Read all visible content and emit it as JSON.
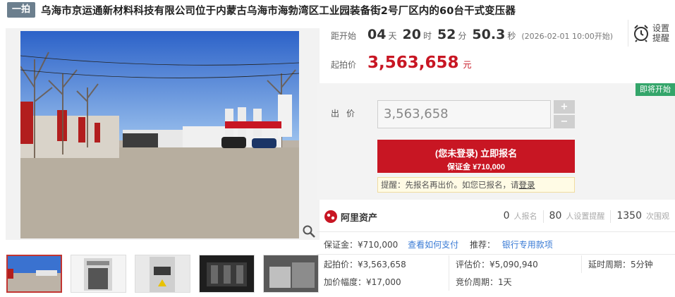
{
  "header": {
    "badge": "一拍",
    "title": "乌海市京运通新材料科技有限公司位于内蒙古乌海市海勃湾区工业园装备街2号厂区内的60台干式变压器"
  },
  "countdown": {
    "label": "距开始",
    "days": "04",
    "days_unit": "天",
    "hours": "20",
    "hours_unit": "时",
    "minutes": "52",
    "minutes_unit": "分",
    "seconds": "50.3",
    "seconds_unit": "秒",
    "start_note": "(2026-02-01 10:00开始)"
  },
  "remind": {
    "label": "设置提醒"
  },
  "starting_price": {
    "label": "起拍价",
    "value": "3,563,658",
    "unit": "元"
  },
  "bid": {
    "status_tag": "即将开始",
    "label": "出价",
    "input_value": "3,563,658",
    "plus": "+",
    "minus": "−",
    "signup_main": "(您未登录) 立即报名",
    "signup_sub": "保证金 ¥710,000",
    "hint_prefix": "提醒：先报名再出价。如您已报名，请",
    "hint_link": "登录"
  },
  "platform": {
    "name": "阿里资产"
  },
  "stats": [
    {
      "num": "0",
      "label": "人报名"
    },
    {
      "num": "80",
      "label": "人设置提醒"
    },
    {
      "num": "1350",
      "label": "次围观"
    }
  ],
  "info": {
    "deposit_label": "保证金：",
    "deposit_value": "¥710,000",
    "deposit_link": "查看如何支付",
    "recommend_label": "推荐：",
    "recommend_link": "银行专用款项",
    "start_label": "起拍价：",
    "start_value": "¥3,563,658",
    "appraise_label": "评估价：",
    "appraise_value": "¥5,090,940",
    "delay_label": "延时周期：",
    "delay_value": "5分钟",
    "increment_label": "加价幅度：",
    "increment_value": "¥17,000",
    "cycle_label": "竞价周期：",
    "cycle_value": "1天"
  },
  "colors": {
    "brand_red": "#c81623",
    "green_tag": "#34a56a",
    "link_blue": "#3a7bd5"
  },
  "icons": {
    "zoom": "magnifier-icon",
    "remind": "alarm-clock-icon",
    "logo": "ali-asset-logo-icon"
  }
}
